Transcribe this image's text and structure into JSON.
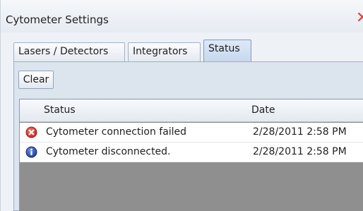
{
  "window": {
    "title": "Cytometer Settings",
    "close_glyph": "✕"
  },
  "tabs": [
    {
      "label": "Lasers / Detectors",
      "selected": false
    },
    {
      "label": "Integrators",
      "selected": false
    },
    {
      "label": "Status",
      "selected": true
    }
  ],
  "toolbar": {
    "clear_label": "Clear"
  },
  "grid": {
    "columns": [
      "Status",
      "Date"
    ],
    "rows": [
      {
        "icon": "error-icon",
        "status": "Cytometer connection failed",
        "date": "2/28/2011 2:58 PM"
      },
      {
        "icon": "info-icon",
        "status": "Cytometer disconnected.",
        "date": "2/28/2011 2:58 PM"
      }
    ]
  },
  "colors": {
    "error": "#d6342b",
    "info": "#1f4fb3",
    "close": "#e53a28",
    "grid_empty": "#8f8f8f"
  }
}
